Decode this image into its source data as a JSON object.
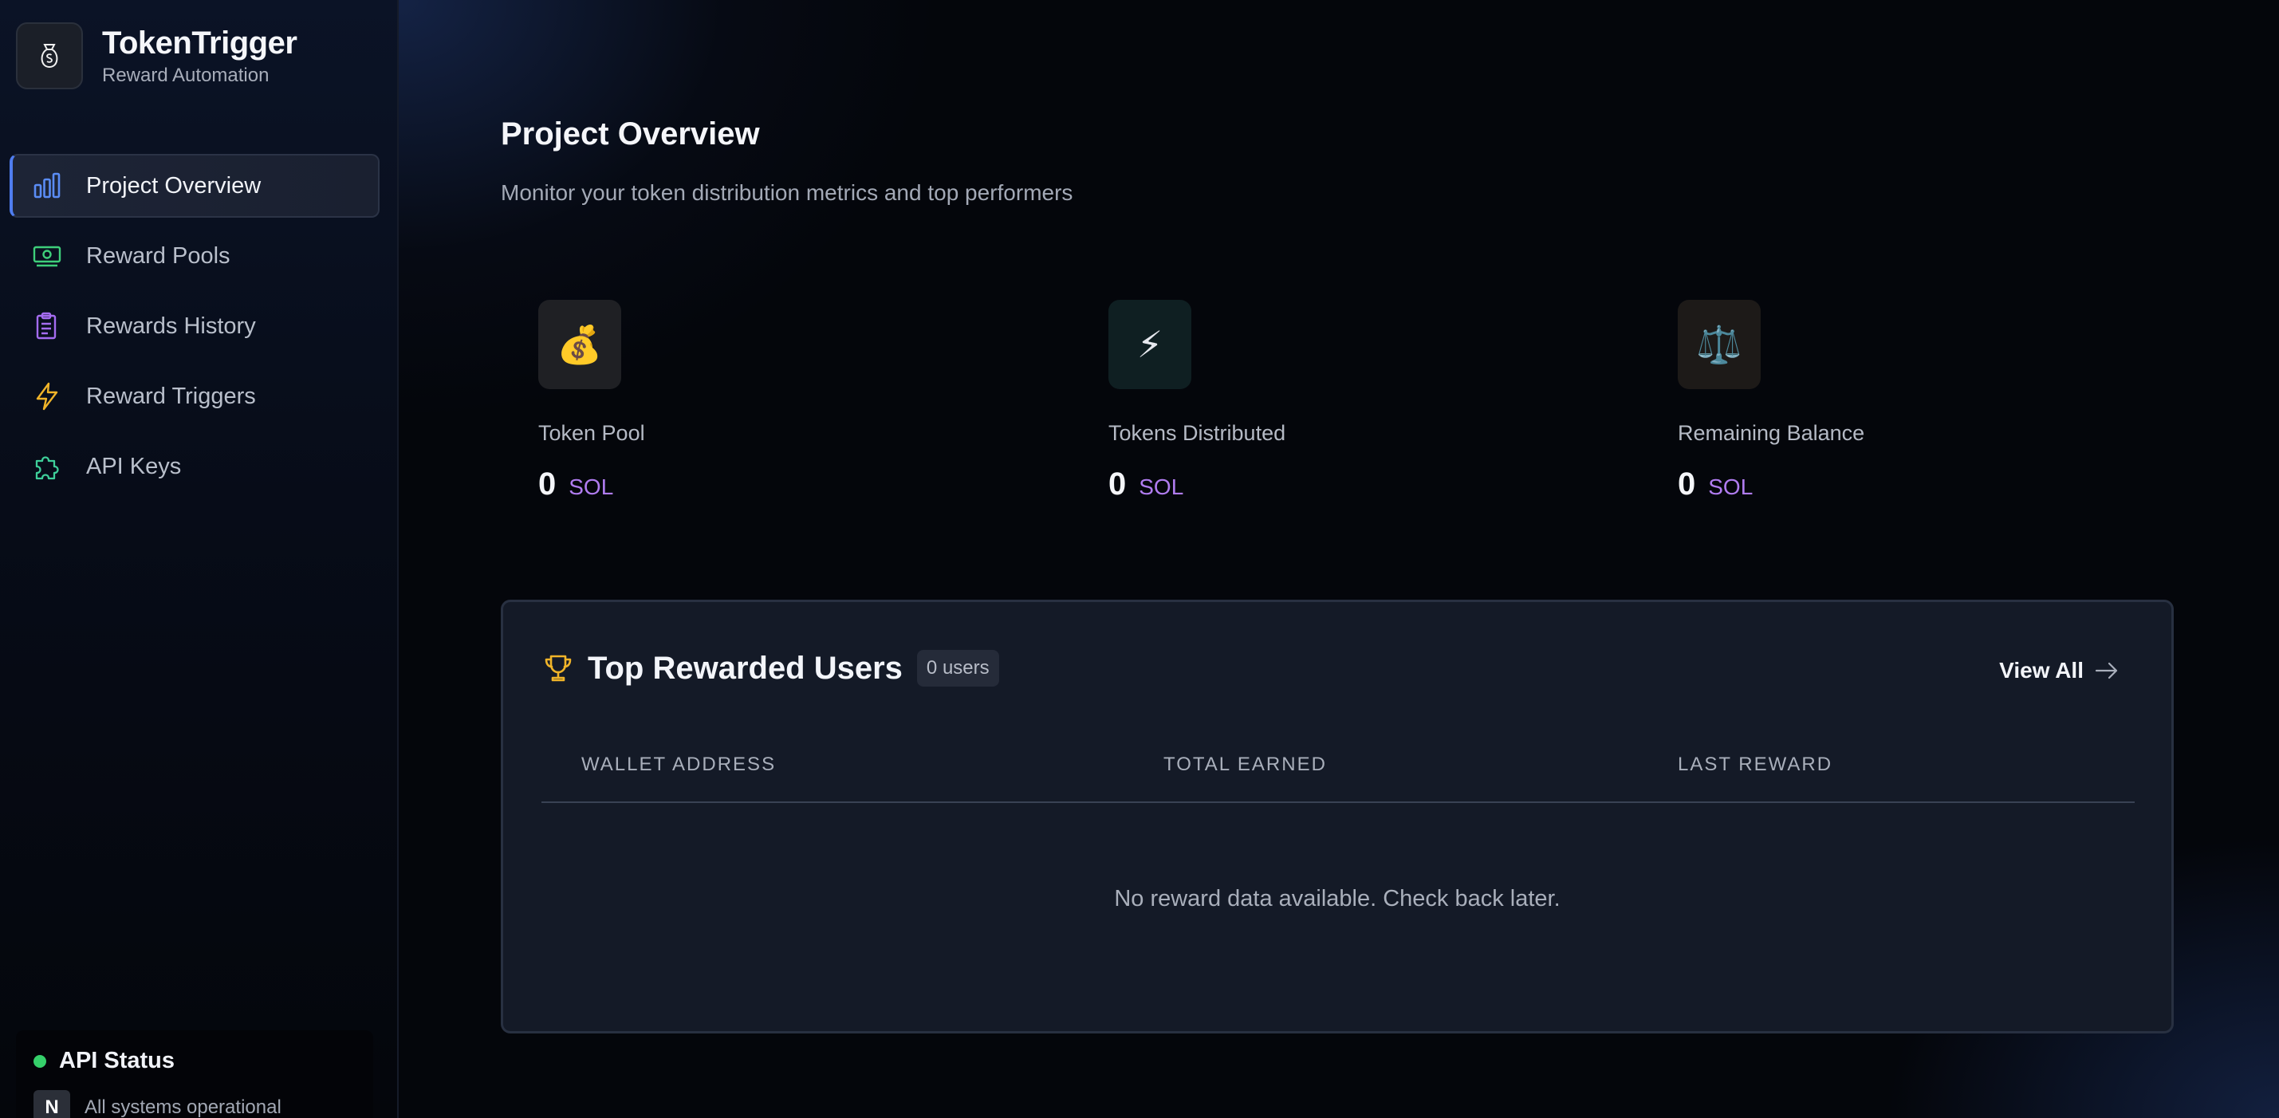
{
  "brand": {
    "title": "TokenTrigger",
    "subtitle": "Reward Automation",
    "logo_icon": "money-bag-icon"
  },
  "sidebar": {
    "items": [
      {
        "label": "Project Overview",
        "icon": "bar-chart-icon",
        "active": true
      },
      {
        "label": "Reward Pools",
        "icon": "banknote-icon",
        "active": false
      },
      {
        "label": "Rewards History",
        "icon": "clipboard-icon",
        "active": false
      },
      {
        "label": "Reward Triggers",
        "icon": "lightning-icon",
        "active": false
      },
      {
        "label": "API Keys",
        "icon": "puzzle-icon",
        "active": false
      }
    ],
    "api_status": {
      "title": "API Status",
      "badge": "N",
      "text": "All systems operational",
      "status_color": "#35d06a"
    }
  },
  "main": {
    "title": "Project Overview",
    "subtitle": "Monitor your token distribution metrics and top performers",
    "stats": [
      {
        "label": "Token Pool",
        "value": "0",
        "unit": "SOL",
        "icon": "money-bag-icon",
        "emoji": "💰"
      },
      {
        "label": "Tokens Distributed",
        "value": "0",
        "unit": "SOL",
        "icon": "lightning-icon",
        "emoji": "⚡"
      },
      {
        "label": "Remaining Balance",
        "value": "0",
        "unit": "SOL",
        "icon": "scales-icon",
        "emoji": "⚖️"
      }
    ],
    "top_users": {
      "title": "Top Rewarded Users",
      "count_badge": "0 users",
      "view_all": "View All",
      "columns": [
        "WALLET ADDRESS",
        "TOTAL EARNED",
        "LAST REWARD"
      ],
      "empty_message": "No reward data available. Check back later."
    }
  },
  "colors": {
    "accent_blue": "#4f7df0",
    "unit_purple": "#b07cf0",
    "trophy_gold": "#f0b429",
    "status_green": "#35d06a"
  }
}
